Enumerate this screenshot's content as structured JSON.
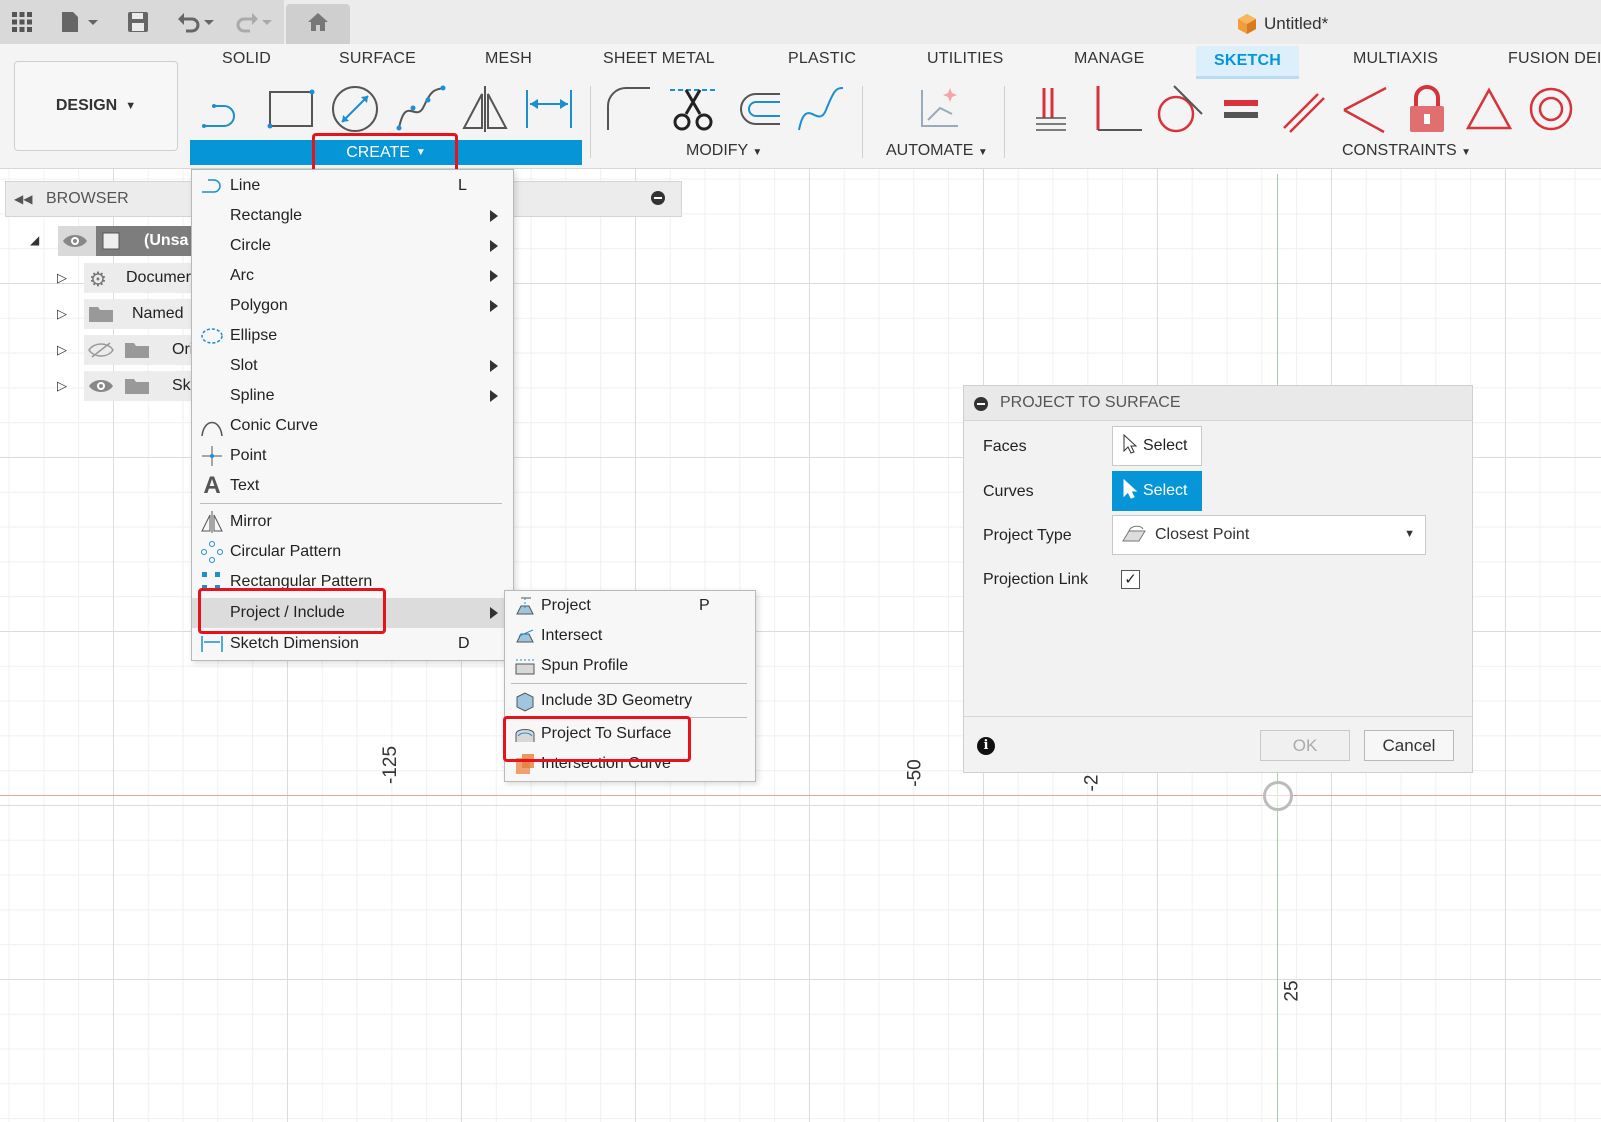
{
  "app": {
    "title": "Untitled*"
  },
  "ribbon": {
    "design_label": "DESIGN",
    "tabs": [
      "SOLID",
      "SURFACE",
      "MESH",
      "SHEET METAL",
      "PLASTIC",
      "UTILITIES",
      "MANAGE",
      "SKETCH",
      "MULTIAXIS",
      "FUSION DEI"
    ],
    "active_tab": "SKETCH",
    "groups": {
      "create": "CREATE",
      "modify": "MODIFY",
      "automate": "AUTOMATE",
      "constraints": "CONSTRAINTS"
    }
  },
  "browser": {
    "title": "BROWSER",
    "items": [
      {
        "label": "(Unsa"
      },
      {
        "label": "Documer"
      },
      {
        "label": "Named"
      },
      {
        "label": "Ori"
      },
      {
        "label": "Sk"
      }
    ]
  },
  "create_menu": {
    "items": [
      {
        "label": "Line",
        "shortcut": "L"
      },
      {
        "label": "Rectangle"
      },
      {
        "label": "Circle"
      },
      {
        "label": "Arc"
      },
      {
        "label": "Polygon"
      },
      {
        "label": "Ellipse"
      },
      {
        "label": "Slot"
      },
      {
        "label": "Spline"
      },
      {
        "label": "Conic Curve"
      },
      {
        "label": "Point"
      },
      {
        "label": "Text"
      },
      {
        "label": "Mirror"
      },
      {
        "label": "Circular Pattern"
      },
      {
        "label": "Rectangular Pattern"
      },
      {
        "label": "Project / Include"
      },
      {
        "label": "Sketch Dimension",
        "shortcut": "D"
      }
    ]
  },
  "submenu": {
    "items": [
      {
        "label": "Project",
        "shortcut": "P"
      },
      {
        "label": "Intersect"
      },
      {
        "label": "Spun Profile"
      },
      {
        "label": "Include 3D Geometry"
      },
      {
        "label": "Project To Surface"
      },
      {
        "label": "Intersection Curve"
      }
    ]
  },
  "dialog": {
    "title": "PROJECT TO SURFACE",
    "faces_label": "Faces",
    "faces_button": "Select",
    "curves_label": "Curves",
    "curves_button": "Select",
    "project_type_label": "Project Type",
    "project_type_value": "Closest Point",
    "projection_link_label": "Projection Link",
    "projection_link_checked": true,
    "ok": "OK",
    "cancel": "Cancel"
  },
  "canvas": {
    "axis_labels": [
      "-125",
      "-50",
      "-2",
      "25"
    ]
  },
  "colors": {
    "accent": "#0696d7",
    "highlight": "#e8121b",
    "constraint_red": "#d6343a"
  }
}
